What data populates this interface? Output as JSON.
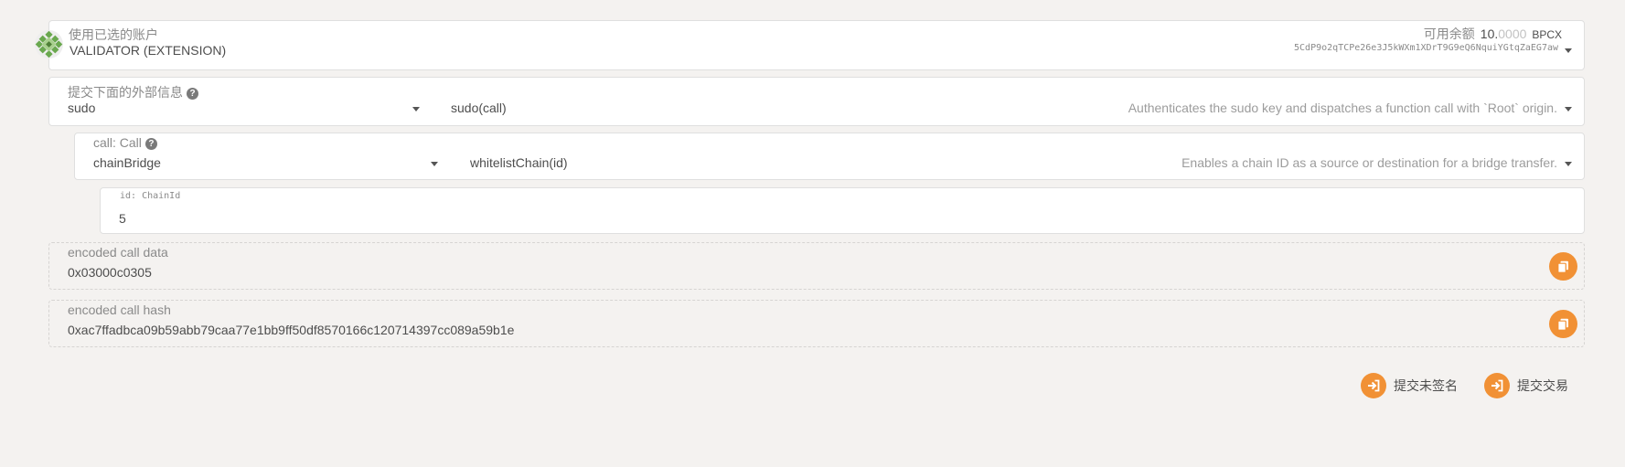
{
  "account": {
    "label": "使用已选的账户",
    "name": "VALIDATOR (EXTENSION)",
    "balance_label": "可用余额",
    "balance_int": "10.",
    "balance_dec": "0000",
    "balance_unit": "BPCX",
    "address": "5CdP9o2qTCPe26e3J5kWXm1XDrT9G9eQ6NquiYGtqZaEG7aw"
  },
  "extrinsic": {
    "label": "提交下面的外部信息",
    "module": "sudo",
    "method": "sudo(call)",
    "description": "Authenticates the sudo key and dispatches a function call with `Root` origin."
  },
  "call": {
    "label": "call: Call",
    "module": "chainBridge",
    "method": "whitelistChain(id)",
    "description": "Enables a chain ID as a source or destination for a bridge transfer."
  },
  "param": {
    "label": "id: ChainId",
    "value": "5"
  },
  "encoded_data": {
    "label": "encoded call data",
    "value": "0x03000c0305"
  },
  "encoded_hash": {
    "label": "encoded call hash",
    "value": "0xac7ffadbca09b59abb79caa77e1bb9ff50df8570166c120714397cc089a59b1e"
  },
  "actions": {
    "unsigned_label": "提交未签名",
    "submit_label": "提交交易"
  },
  "colors": {
    "accent": "#f19135",
    "background": "#f4f2f0"
  }
}
